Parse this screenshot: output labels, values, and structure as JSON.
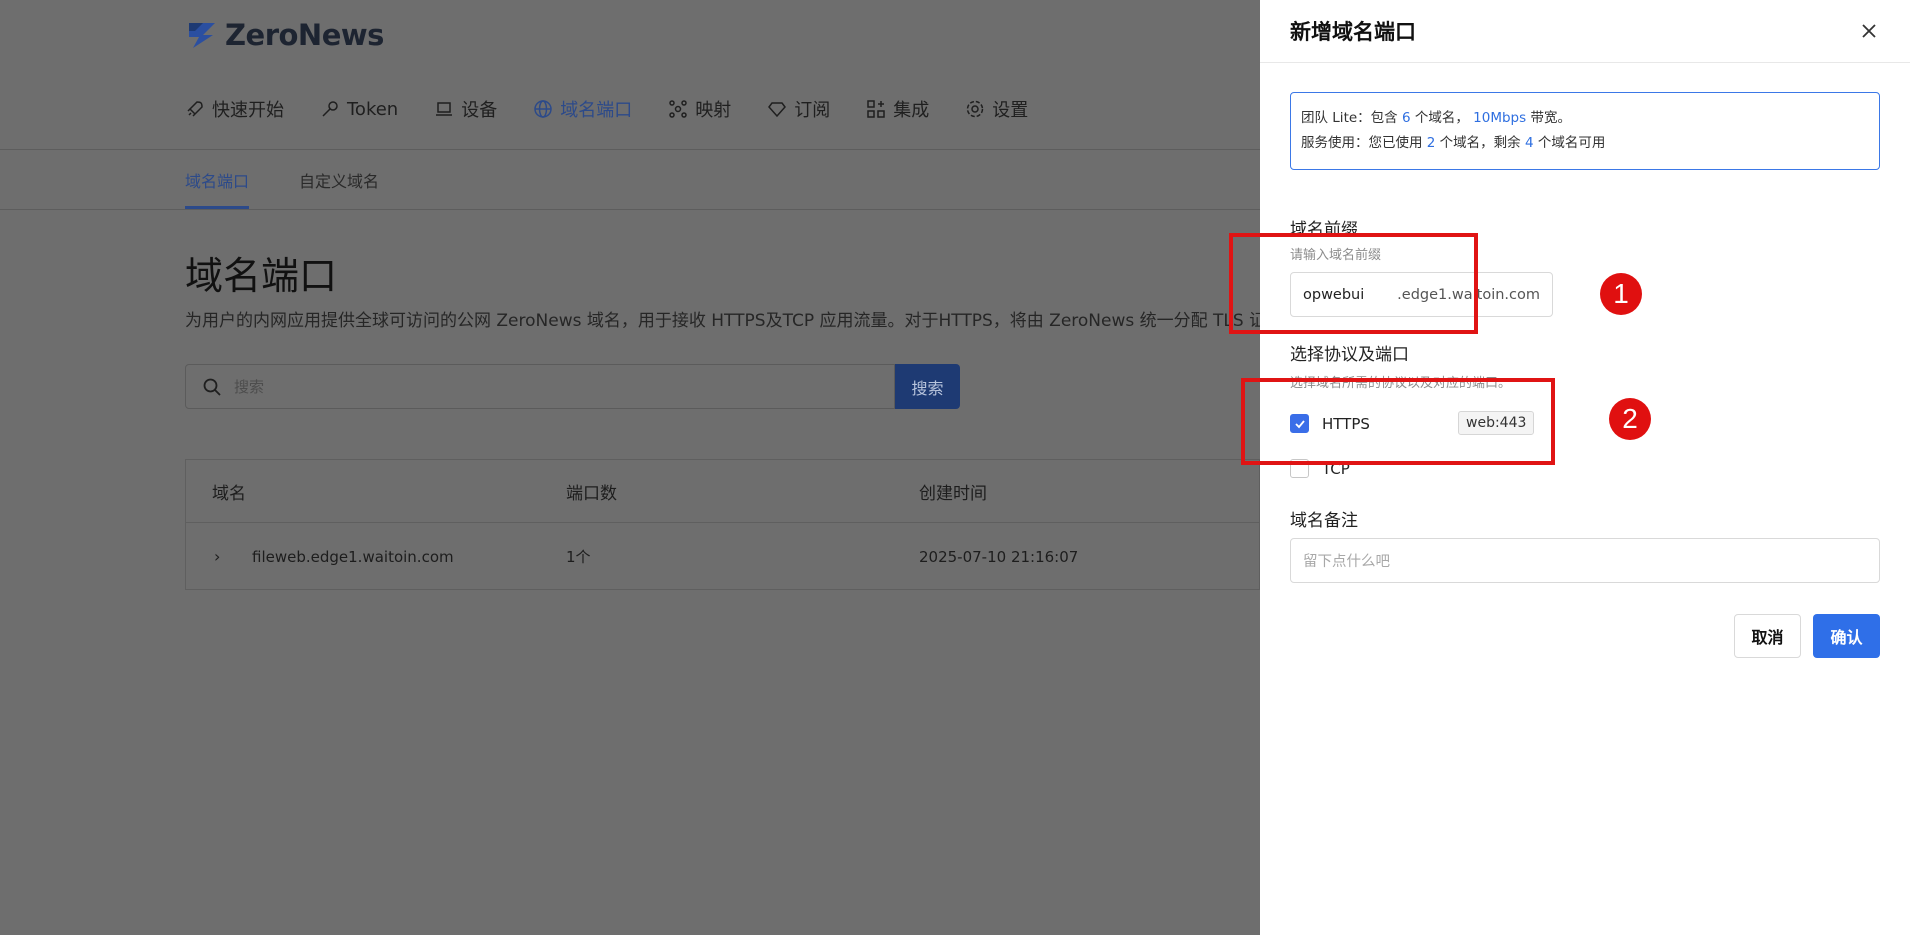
{
  "app": {
    "logo_text": "ZeroNews"
  },
  "nav": {
    "items": [
      {
        "label": "快速开始",
        "icon": "rocket-icon"
      },
      {
        "label": "Token",
        "icon": "key-icon"
      },
      {
        "label": "设备",
        "icon": "laptop-icon"
      },
      {
        "label": "域名端口",
        "icon": "globe-icon",
        "active": true
      },
      {
        "label": "映射",
        "icon": "network-icon"
      },
      {
        "label": "订阅",
        "icon": "diamond-icon"
      },
      {
        "label": "集成",
        "icon": "apps-icon"
      },
      {
        "label": "设置",
        "icon": "gear-icon"
      }
    ]
  },
  "subtabs": {
    "domain_ports": "域名端口",
    "custom_domain": "自定义域名"
  },
  "page": {
    "title": "域名端口",
    "description": "为用户的内网应用提供全球可访问的公网 ZeroNews 域名，用于接收 HTTPS及TCP 应用流量。对于HTTPS，将由 ZeroNews 统一分配 TLS 证书",
    "search_placeholder": "搜索",
    "search_button": "搜索"
  },
  "table": {
    "headers": [
      "域名",
      "端口数",
      "创建时间"
    ],
    "rows": [
      {
        "domain": "fileweb.edge1.waitoin.com",
        "ports": "1个",
        "created": "2025-07-10 21:16:07"
      }
    ]
  },
  "drawer": {
    "title": "新增域名端口",
    "info": {
      "line1_prefix": "团队 Lite：包含 ",
      "line1_domains": "6",
      "line1_mid": " 个域名，  ",
      "line1_bw": "10Mbps",
      "line1_suffix": " 带宽。",
      "line2_prefix": "服务使用：您已使用 ",
      "line2_used": "2",
      "line2_mid": " 个域名，剩余 ",
      "line2_left": "4",
      "line2_suffix": " 个域名可用"
    },
    "prefix": {
      "label": "域名前缀",
      "hint": "请输入域名前缀",
      "value": "opwebui",
      "suffix": ".edge1.waitoin.com"
    },
    "protocol": {
      "label": "选择协议及端口",
      "hint": "选择域名所需的协议以及对应的端口。",
      "options": [
        {
          "name": "HTTPS",
          "checked": true,
          "port": "web:443"
        },
        {
          "name": "TCP",
          "checked": false
        }
      ]
    },
    "remark": {
      "label": "域名备注",
      "placeholder": "留下点什么吧"
    },
    "cancel": "取消",
    "confirm": "确认"
  },
  "annotations": {
    "marker1": "1",
    "marker2": "2"
  },
  "colors": {
    "accent": "#2f6fe8",
    "annotation": "#e01414",
    "overlay": "#6e6e6e"
  }
}
